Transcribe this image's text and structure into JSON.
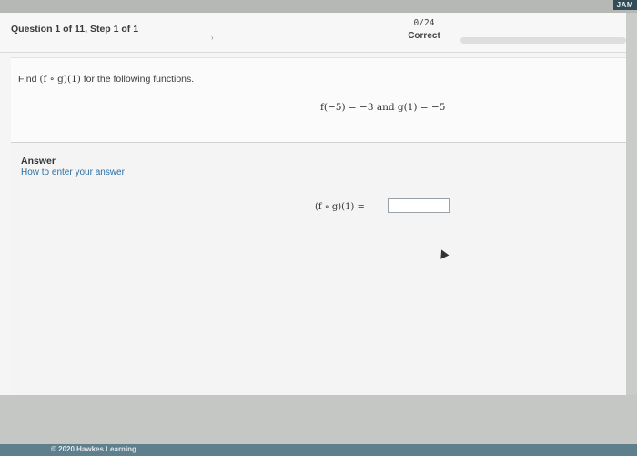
{
  "corner_tag": "JAM",
  "header": {
    "question_title": "Question 1 of 11, Step 1 of 1",
    "chevron_icon": "chevron-right-icon",
    "score_value": "0/24",
    "score_label": "Correct",
    "progress_fraction": 0
  },
  "problem": {
    "prompt_prefix": "Find ",
    "prompt_math": "(f ∘ g)(1)",
    "prompt_suffix": " for the following functions.",
    "given": "f(−5) = −3 and g(1) = −5"
  },
  "answer": {
    "heading": "Answer",
    "help_link": "How to enter your answer",
    "label": "(f ∘ g)(1) =",
    "input_value": ""
  },
  "footer": {
    "copyright": "© 2020 Hawkes Learning"
  },
  "colors": {
    "link": "#2b6ea8",
    "footer_bar": "#5f7f8d",
    "header_bg": "#f7f7f7"
  }
}
